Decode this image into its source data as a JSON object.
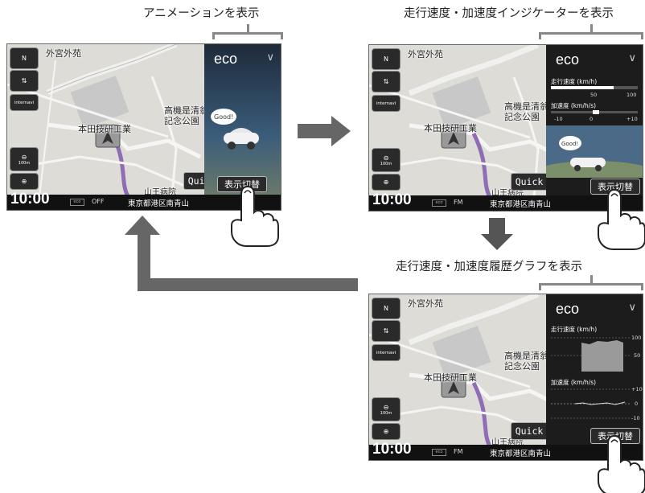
{
  "captions": {
    "animation": "アニメーションを表示",
    "indicator": "走行速度・加速度インジケーターを表示",
    "history_graph": "走行速度・加速度履歴グラフを表示"
  },
  "screens": {
    "common": {
      "time": "10:00",
      "address": "東京都港区南青山",
      "quick_label": "Quick",
      "toggle_label": "表示切替",
      "eco_label": "eco",
      "eco_chevron": "∨",
      "internavi_label": "internavi",
      "scale_label": "100m",
      "map_labels": {
        "shrine": "外宮外苑",
        "memorial": "高機是清翁",
        "park": "記念公園",
        "factory": "本田技研工業",
        "hospital": "山王病院"
      },
      "compass": "N"
    },
    "screen1": {
      "audio_source": "OFF",
      "speech": "Good!"
    },
    "screen2": {
      "audio_source": "FM",
      "speech": "Good!",
      "speed_label": "走行速度 (km/h)",
      "speed_ticks": [
        "50",
        "100"
      ],
      "speed_value_fraction": 0.72,
      "accel_label": "加速度 (km/h/s)",
      "accel_ticks": [
        "-10",
        "0",
        "+10"
      ]
    },
    "screen3": {
      "audio_source": "FM",
      "speed_label": "走行速度 (km/h)",
      "speed_ticks": [
        "100",
        "50"
      ],
      "accel_label": "加速度 (km/h/s)",
      "accel_ticks": [
        "+10",
        "0",
        "-10"
      ]
    }
  },
  "colors": {
    "arrow": "#666666",
    "bracket": "#888888",
    "panel": "#1c1c1c"
  }
}
